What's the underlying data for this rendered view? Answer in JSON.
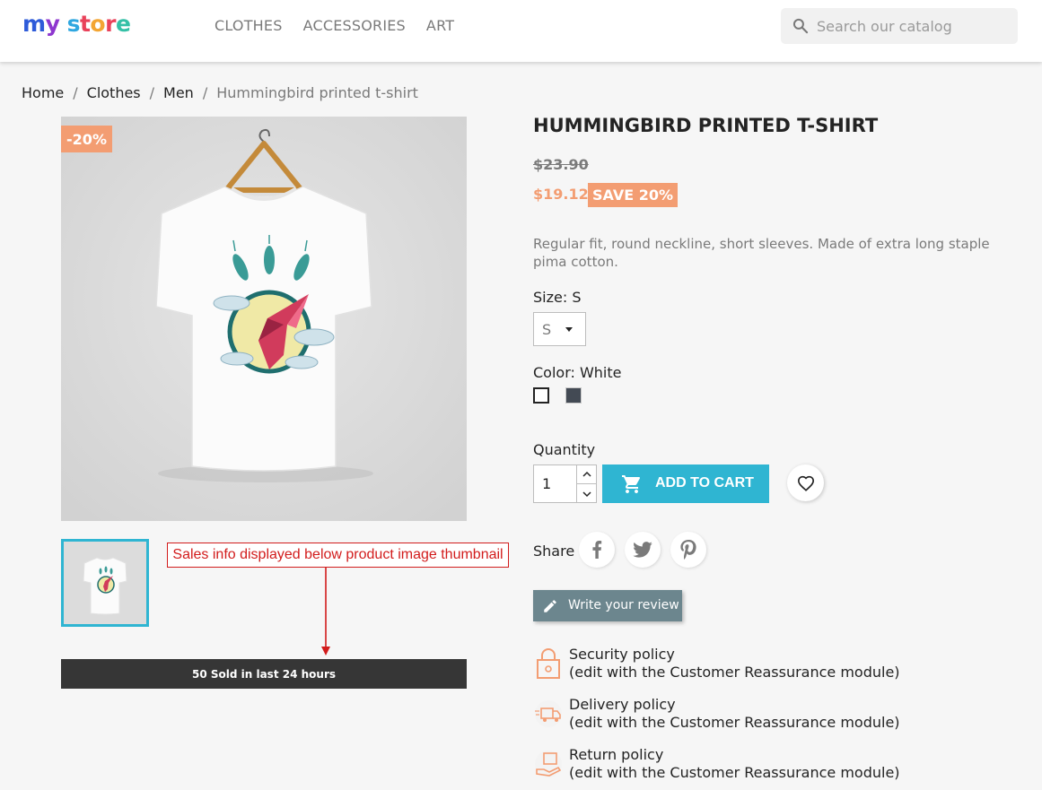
{
  "header": {
    "logo": [
      "m",
      "y",
      " ",
      "s",
      "t",
      "o",
      "r",
      "e"
    ],
    "nav": [
      "CLOTHES",
      "ACCESSORIES",
      "ART"
    ],
    "search_placeholder": "Search our catalog"
  },
  "breadcrumb": {
    "home": "Home",
    "clothes": "Clothes",
    "men": "Men",
    "current": "Hummingbird printed t-shirt",
    "separator": "/"
  },
  "product": {
    "discount_flag": "-20%",
    "title": "HUMMINGBIRD PRINTED T-SHIRT",
    "old_price": "$23.90",
    "price": "$19.12",
    "save_badge": "SAVE 20%",
    "description": "Regular fit, round neckline, short sleeves. Made of extra long staple pima cotton.",
    "size_label": "Size: S",
    "size_value": "S",
    "color_label": "Color: White",
    "quantity_label": "Quantity",
    "quantity_value": "1",
    "add_to_cart": "ADD TO CART",
    "share_label": "Share",
    "review_button": "Write your review"
  },
  "annotation": {
    "text": "Sales info displayed below product image thumbnail"
  },
  "sales_info": "50 Sold in last 24 hours",
  "reassurance": [
    {
      "title": "Security policy",
      "subtitle": "(edit with the Customer Reassurance module)"
    },
    {
      "title": "Delivery policy",
      "subtitle": "(edit with the Customer Reassurance module)"
    },
    {
      "title": "Return policy",
      "subtitle": "(edit with the Customer Reassurance module)"
    }
  ],
  "colors": {
    "accent": "#2fb5d2",
    "discount": "#f39d72",
    "annotation": "#d21c1c",
    "review_button": "#6c868e"
  }
}
